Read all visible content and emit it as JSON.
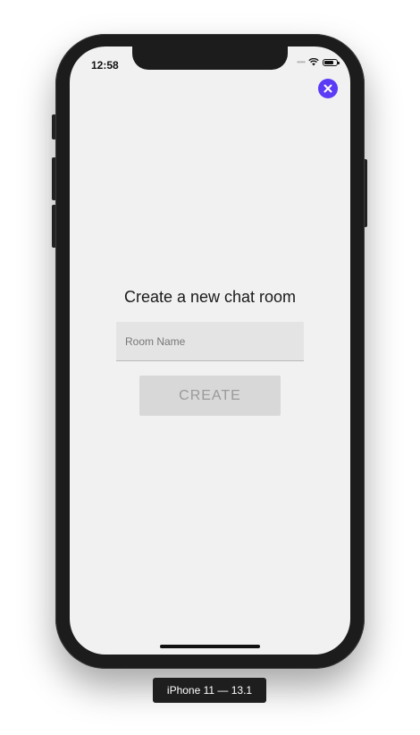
{
  "status_bar": {
    "time": "12:58",
    "signal": "•••••"
  },
  "close_button": {
    "icon": "close-icon",
    "color": "#5b3bf5"
  },
  "form": {
    "title": "Create a new chat room",
    "room_name": {
      "value": "",
      "placeholder": "Room Name"
    },
    "create_label": "CREATE"
  },
  "device_label": "iPhone 11 — 13.1"
}
